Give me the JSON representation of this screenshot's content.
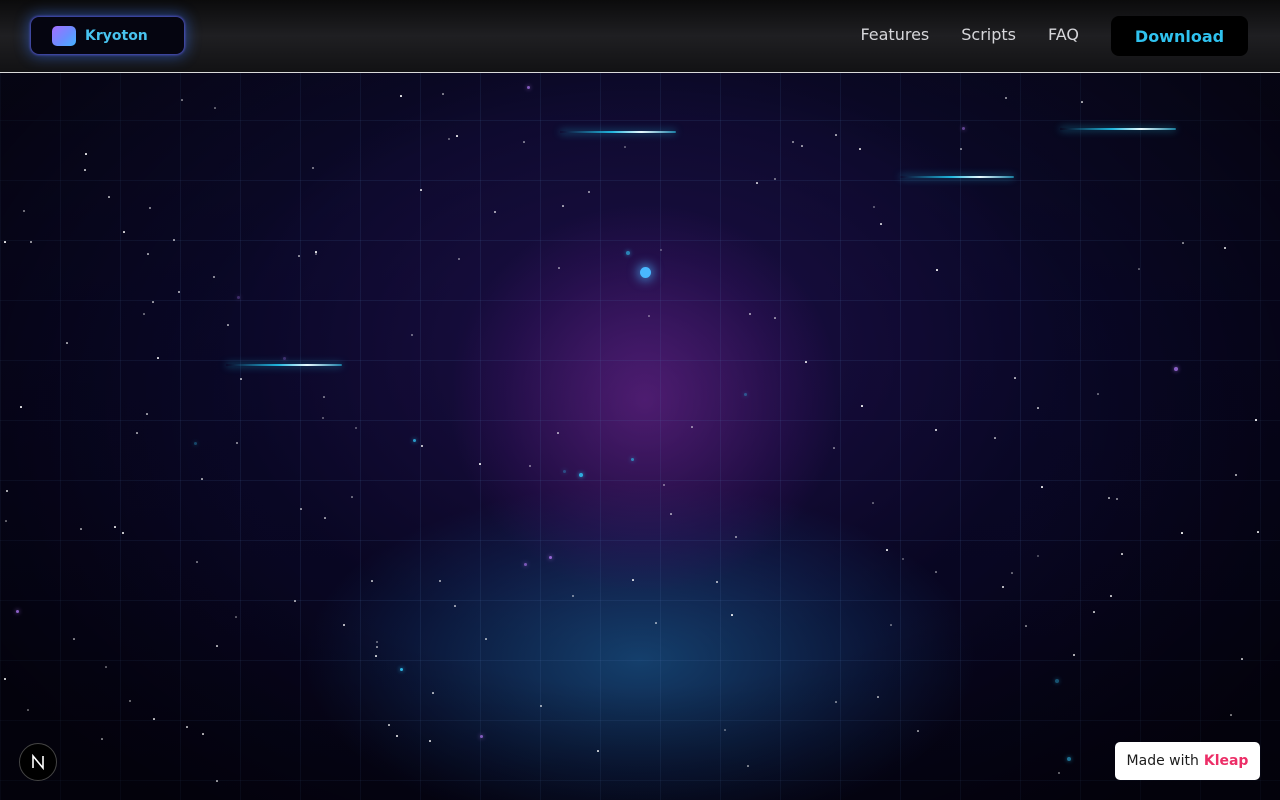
{
  "header": {
    "brand_name": "Kryoton",
    "nav": [
      "Features",
      "Scripts",
      "FAQ"
    ],
    "download_label": "Download"
  },
  "footer": {
    "made_with_prefix": "Made with",
    "made_with_brand": "Kleap",
    "n_badge_icon": "nextjs-n-icon"
  },
  "colors": {
    "accent_cyan": "#2fc2ef",
    "accent_purple": "#a46dff",
    "kleap_pink": "#ec2e67",
    "background": "#05040f"
  }
}
